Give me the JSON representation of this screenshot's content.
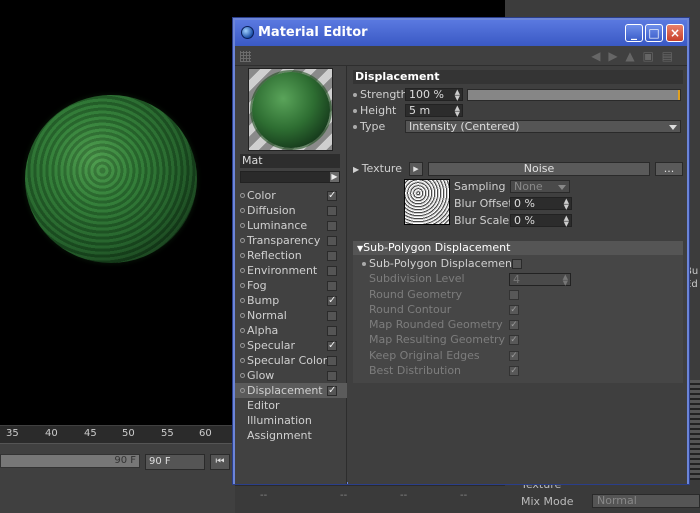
{
  "window": {
    "title": "Material Editor"
  },
  "window_buttons": [
    "_",
    "□",
    "×"
  ],
  "timeline": {
    "ticks": [
      "35",
      "40",
      "45",
      "50",
      "55",
      "60"
    ],
    "end_frame_a": "90 F",
    "end_frame_b": "90 F"
  },
  "material": {
    "name": "Mat"
  },
  "channels": [
    {
      "label": "Color",
      "checked": "✓"
    },
    {
      "label": "Diffusion",
      "checked": ""
    },
    {
      "label": "Luminance",
      "checked": ""
    },
    {
      "label": "Transparency",
      "checked": ""
    },
    {
      "label": "Reflection",
      "checked": ""
    },
    {
      "label": "Environment",
      "checked": ""
    },
    {
      "label": "Fog",
      "checked": ""
    },
    {
      "label": "Bump",
      "checked": "✓"
    },
    {
      "label": "Normal",
      "checked": ""
    },
    {
      "label": "Alpha",
      "checked": ""
    },
    {
      "label": "Specular",
      "checked": "✓"
    },
    {
      "label": "Specular Color",
      "checked": ""
    },
    {
      "label": "Glow",
      "checked": ""
    },
    {
      "label": "Displacement",
      "checked": "✓"
    }
  ],
  "extra_items": [
    "Editor",
    "Illumination",
    "Assignment"
  ],
  "displacement": {
    "section_title": "Displacement",
    "strength_label": "Strength",
    "strength_value": "100 %",
    "height_label": "Height",
    "height_value": "5 m",
    "type_label": "Type",
    "type_value": "Intensity (Centered)",
    "texture_label": "Texture",
    "texture_button": "Noise",
    "texture_more": "...",
    "sampling_label": "Sampling",
    "sampling_value": "None",
    "blur_offset_label": "Blur Offset",
    "blur_offset_value": "0 %",
    "blur_scale_label": "Blur Scale",
    "blur_scale_value": "0 %"
  },
  "subpoly": {
    "header": "Sub-Polygon Displacement",
    "toggle_label": "Sub-Polygon Displacement",
    "rows": [
      {
        "label": "Subdivision Level",
        "value": "4"
      },
      {
        "label": "Round Geometry",
        "checked": ""
      },
      {
        "label": "Round Contour",
        "checked": "✓"
      },
      {
        "label": "Map Rounded Geometry",
        "checked": "✓"
      },
      {
        "label": "Map Resulting Geometry",
        "checked": "✓"
      },
      {
        "label": "Keep Original Edges",
        "checked": "✓"
      },
      {
        "label": "Best Distribution",
        "checked": "✓"
      }
    ]
  },
  "background_panel": {
    "texture_label": "Texture",
    "mix_mode_label": "Mix Mode",
    "mix_mode_value": "Normal",
    "edge_text_1": "Bu",
    "edge_text_2": "Ed"
  },
  "status": [
    "--",
    "--",
    "--",
    "--"
  ]
}
